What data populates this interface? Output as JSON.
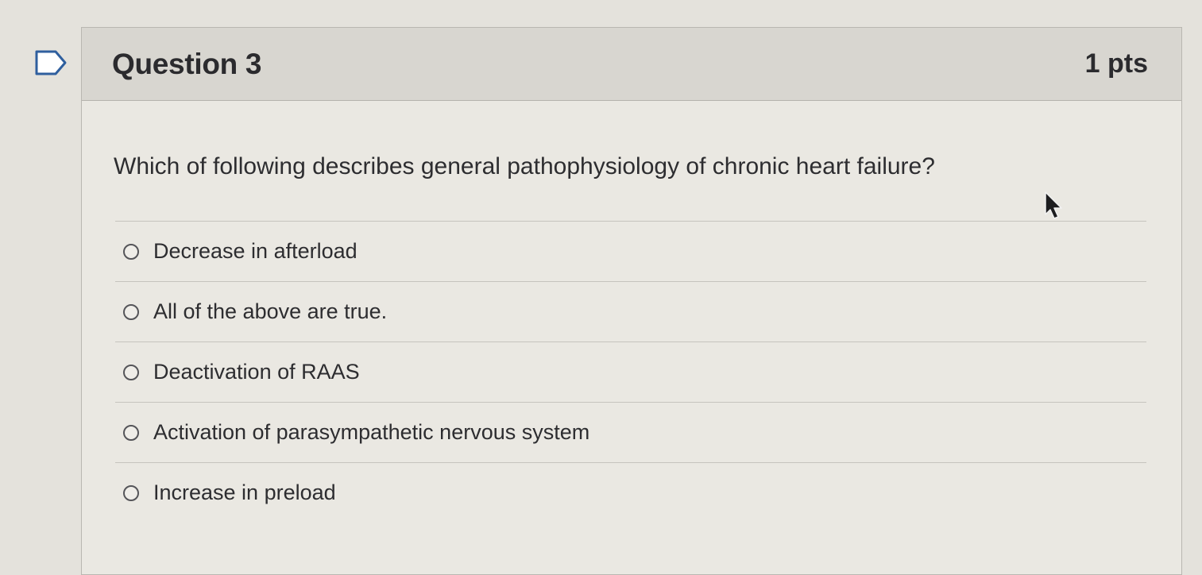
{
  "question": {
    "title": "Question 3",
    "points": "1 pts",
    "text": "Which of following describes general pathophysiology of chronic heart failure?"
  },
  "answers": [
    {
      "label": "Decrease in afterload",
      "selected": false
    },
    {
      "label": "All of the above are true.",
      "selected": false
    },
    {
      "label": "Deactivation of RAAS",
      "selected": false
    },
    {
      "label": "Activation of parasympathetic nervous system",
      "selected": false
    },
    {
      "label": "Increase in preload",
      "selected": false
    }
  ],
  "icons": {
    "flag": "flag-question-icon",
    "cursor": "mouse-pointer-icon"
  }
}
